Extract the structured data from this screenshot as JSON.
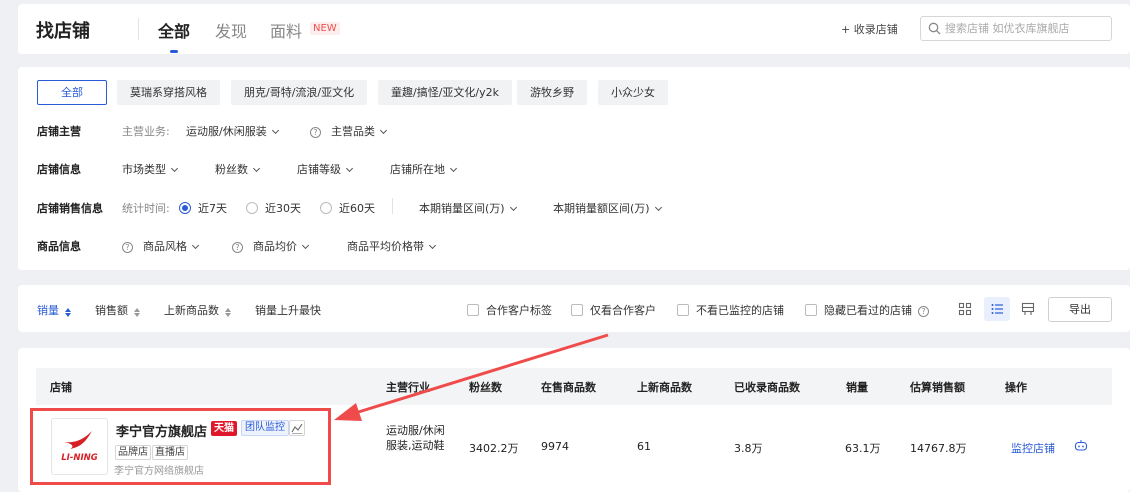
{
  "header": {
    "title": "找店铺",
    "tabs": [
      {
        "label": "全部",
        "active": true
      },
      {
        "label": "发现",
        "active": false
      },
      {
        "label": "面料",
        "active": false
      }
    ],
    "new_badge": "NEW",
    "collect_label": "+ 收录店铺",
    "search_placeholder": "搜索店铺 如优衣库旗舰店"
  },
  "filters": {
    "chips": [
      "全部",
      "莫瑞系穿搭风格",
      "朋克/哥特/流浪/亚文化",
      "童趣/搞怪/亚文化/y2k",
      "游牧乡野",
      "小众少女"
    ],
    "row1": {
      "label": "店铺主营",
      "business_label": "主营业务:",
      "business_value": "运动服/休闲服装",
      "category": "主营品类"
    },
    "row2": {
      "label": "店铺信息",
      "items": [
        "市场类型",
        "粉丝数",
        "店铺等级",
        "店铺所在地"
      ]
    },
    "row3": {
      "label": "店铺销售信息",
      "time_label": "统计时间:",
      "options": [
        "近7天",
        "近30天",
        "近60天"
      ],
      "selected": "近7天",
      "sales_range": "本期销量区间(万)",
      "amount_range": "本期销量额区间(万)"
    },
    "row4": {
      "label": "商品信息",
      "style": "商品风格",
      "avg_price": "商品均价",
      "price_band": "商品平均价格带"
    }
  },
  "sortbar": {
    "sorts": [
      "销量",
      "销售额",
      "上新商品数",
      "销量上升最快"
    ],
    "checkboxes": [
      "合作客户标签",
      "仅看合作客户",
      "不看已监控的店铺",
      "隐藏已看过的店铺"
    ],
    "export_label": "导出"
  },
  "table": {
    "headers": [
      "店铺",
      "主营行业",
      "粉丝数",
      "在售商品数",
      "上新商品数",
      "已收录商品数",
      "销量",
      "估算销售额",
      "操作"
    ],
    "rows": [
      {
        "shop_name": "李宁官方旗舰店",
        "badge_tmall": "天猫",
        "badge_team": "团队监控",
        "tags": [
          "品牌店",
          "直播店"
        ],
        "company": "李宁官方网络旗舰店",
        "logo_text": "LI-NING",
        "industry": "运动服/休闲服装,运动鞋",
        "fans": "3402.2万",
        "on_sale": "9974",
        "new_items": "61",
        "collected": "3.8万",
        "sales": "63.1万",
        "revenue": "14767.8万",
        "action": "监控店铺"
      }
    ]
  },
  "colors": {
    "accent": "#2a5bd7",
    "annotation": "#ef4b4b",
    "tmall": "#e0162b"
  }
}
